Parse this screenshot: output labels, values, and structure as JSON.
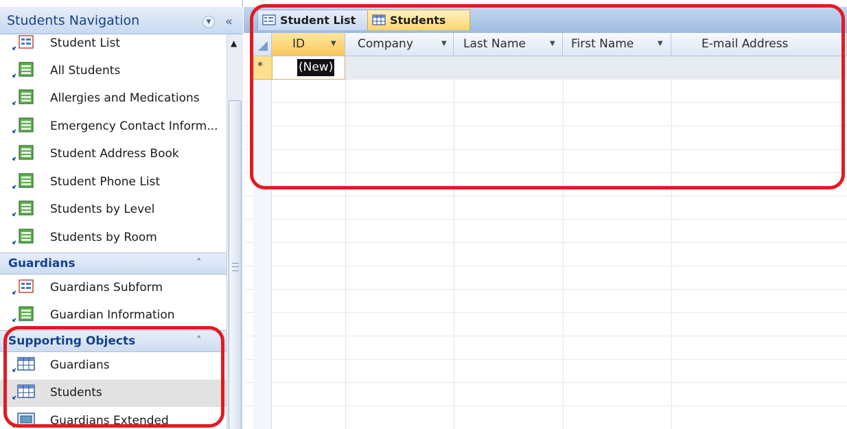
{
  "navigation": {
    "title": "Students Navigation",
    "dropdown_icon": "chevron-down-icon",
    "collapse_icon": "double-chevron-left-icon",
    "items": [
      {
        "label": "Student List",
        "icon": "form-icon"
      },
      {
        "label": "All Students",
        "icon": "report-icon"
      },
      {
        "label": "Allergies and Medications",
        "icon": "report-icon"
      },
      {
        "label": "Emergency Contact Inform...",
        "icon": "report-icon"
      },
      {
        "label": "Student Address Book",
        "icon": "report-icon"
      },
      {
        "label": "Student Phone List",
        "icon": "report-icon"
      },
      {
        "label": "Students by Level",
        "icon": "report-icon"
      },
      {
        "label": "Students by Room",
        "icon": "report-icon"
      }
    ],
    "groups": [
      {
        "label": "Guardians",
        "toggle": "≈",
        "items": [
          {
            "label": "Guardians Subform",
            "icon": "form-icon"
          },
          {
            "label": "Guardian Information",
            "icon": "report-icon"
          }
        ]
      },
      {
        "label": "Supporting Objects",
        "toggle": "≈",
        "items": [
          {
            "label": "Guardians",
            "icon": "table-icon"
          },
          {
            "label": "Students",
            "icon": "table-icon",
            "selected": true
          },
          {
            "label": "Guardians Extended",
            "icon": "query-icon"
          }
        ]
      }
    ]
  },
  "tabs": [
    {
      "label": "Student List",
      "icon": "form-icon",
      "active": false
    },
    {
      "label": "Students",
      "icon": "table-icon",
      "active": true
    }
  ],
  "datasheet": {
    "columns": [
      {
        "label": "ID",
        "has_dropdown": true,
        "active": true
      },
      {
        "label": "Company",
        "has_dropdown": true
      },
      {
        "label": "Last Name",
        "has_dropdown": true
      },
      {
        "label": "First Name",
        "has_dropdown": true
      },
      {
        "label": "E-mail Address",
        "has_dropdown": false
      }
    ],
    "new_row_marker": "*",
    "new_row_id": "(New)"
  },
  "colors": {
    "annotation": "#e11b22",
    "header_text": "#15428b",
    "active_tab": "#ffd56e",
    "selected_item": "#e2e2e2"
  }
}
